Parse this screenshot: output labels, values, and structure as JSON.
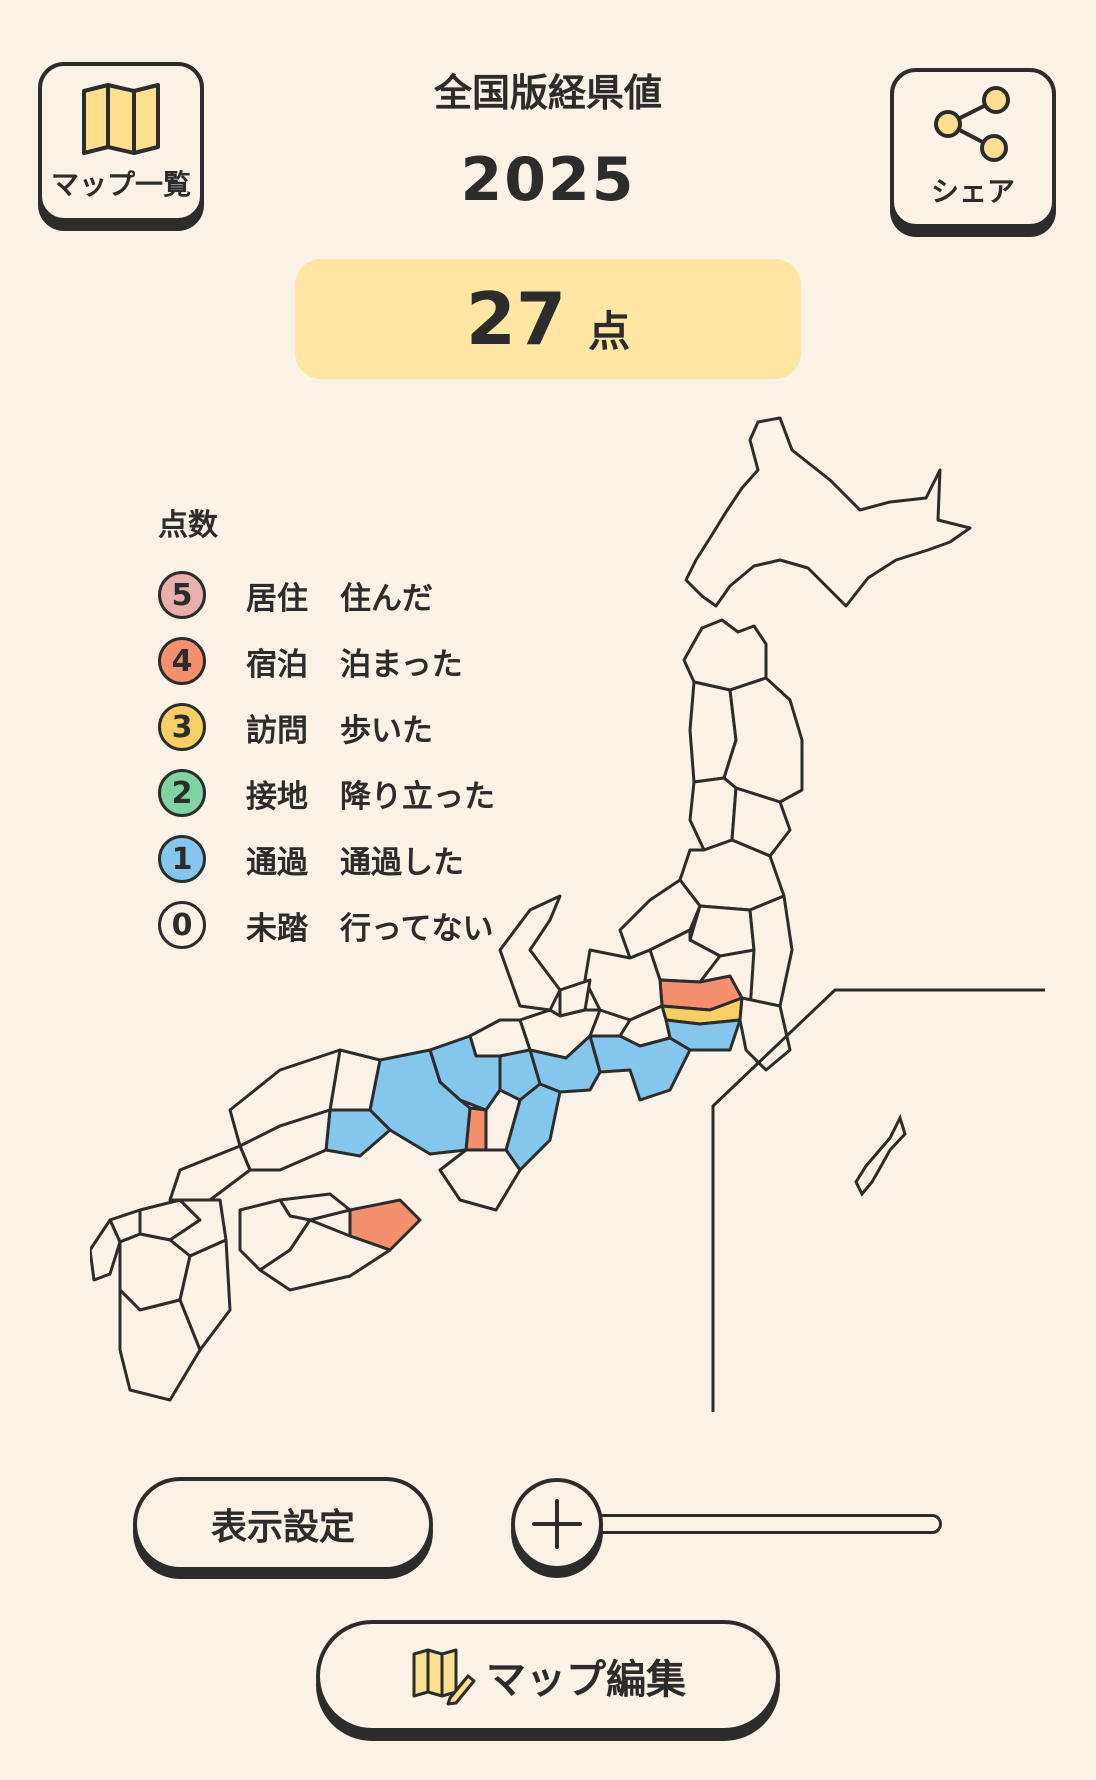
{
  "header": {
    "maps_button_label": "マップ一覧",
    "share_button_label": "シェア",
    "title": "全国版経県値",
    "year": "2025"
  },
  "score": {
    "value": "27",
    "unit": "点"
  },
  "legend": {
    "title": "点数",
    "items": [
      {
        "score": "5",
        "level": "居住",
        "desc": "住んだ",
        "color": "#e8b0ad"
      },
      {
        "score": "4",
        "level": "宿泊",
        "desc": "泊まった",
        "color": "#f4906e"
      },
      {
        "score": "3",
        "level": "訪問",
        "desc": "歩いた",
        "color": "#f9cf63"
      },
      {
        "score": "2",
        "level": "接地",
        "desc": "降り立った",
        "color": "#7fd4a2"
      },
      {
        "score": "1",
        "level": "通過",
        "desc": "通過した",
        "color": "#84c6ec"
      },
      {
        "score": "0",
        "level": "未踏",
        "desc": "行ってない",
        "color": "#fbf2e7"
      }
    ]
  },
  "controls": {
    "display_settings_label": "表示設定",
    "zoom_icon": "plus-icon",
    "edit_map_label": "マップ編集"
  },
  "colors": {
    "background": "#fbf2e7",
    "outline": "#2c2c2c",
    "score_box": "#ffe7a3",
    "icon_yellow": "#fde08f"
  }
}
